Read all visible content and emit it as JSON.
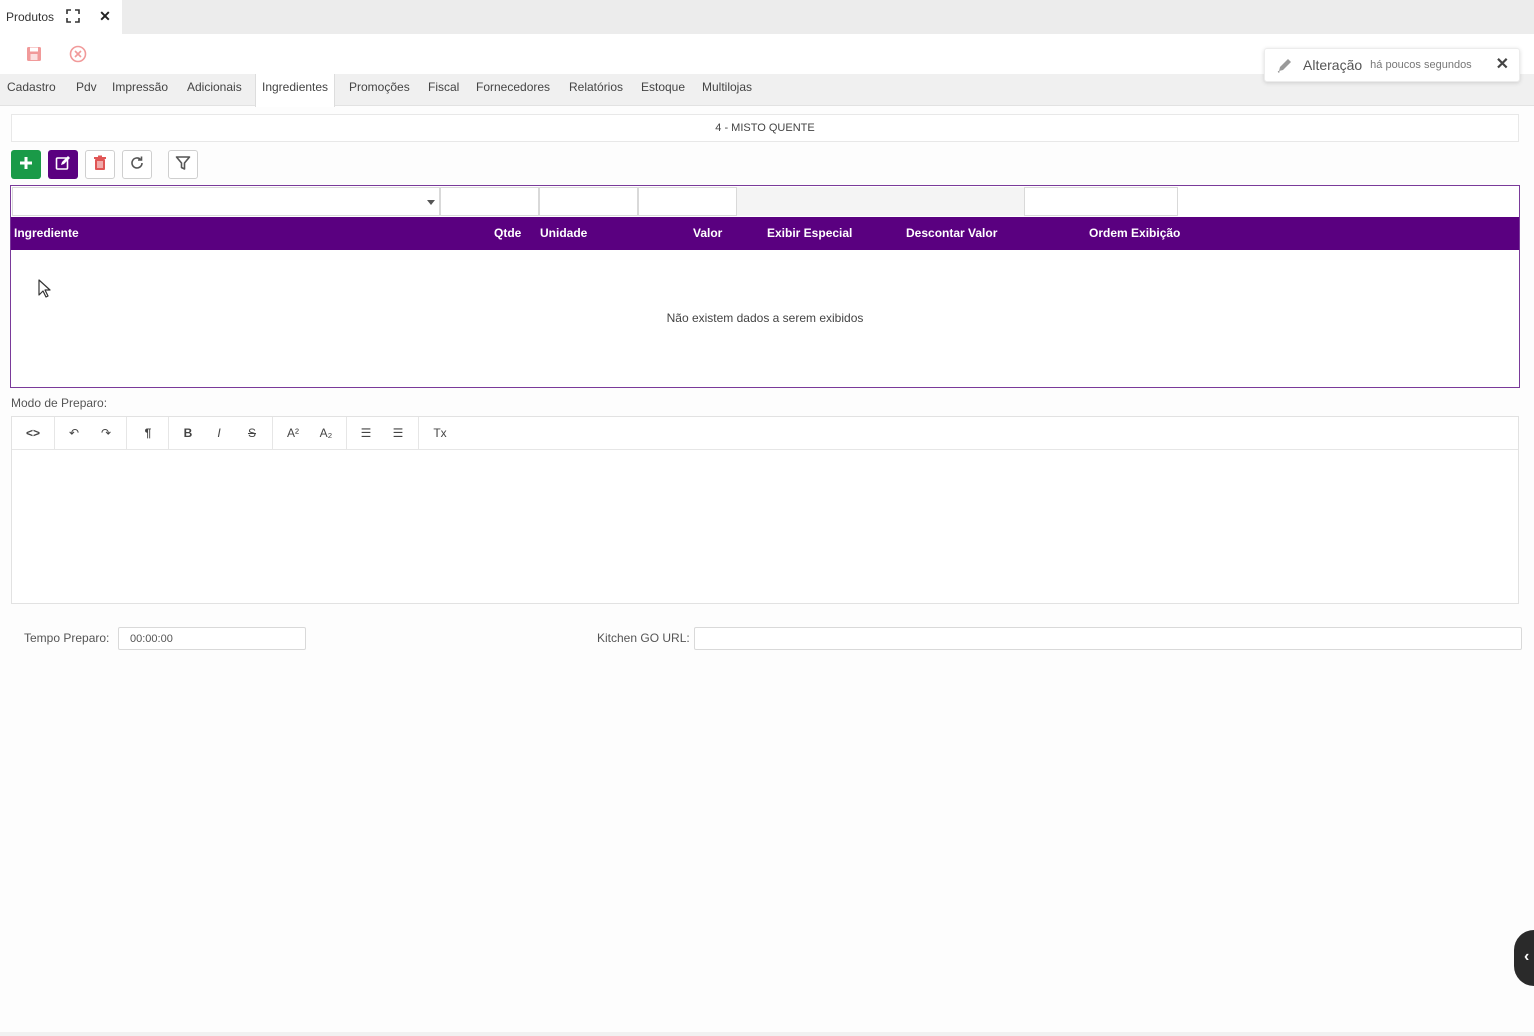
{
  "window": {
    "tab_title": "Produtos",
    "maximize_icon": "expand-icon",
    "close_icon": "close-icon",
    "close_glyph": "✕"
  },
  "actions": {
    "save_icon": "save-icon",
    "cancel_icon": "cancel-circle-icon"
  },
  "notification": {
    "icon": "pencil-icon",
    "title": "Alteração",
    "time": "há poucos segundos",
    "close_glyph": "✕"
  },
  "tabs": [
    {
      "label": "Cadastro"
    },
    {
      "label": "Pdv"
    },
    {
      "label": "Impressão"
    },
    {
      "label": "Adicionais"
    },
    {
      "label": "Ingredientes",
      "active": true
    },
    {
      "label": "Promoções"
    },
    {
      "label": "Fiscal"
    },
    {
      "label": "Fornecedores"
    },
    {
      "label": "Relatórios"
    },
    {
      "label": "Estoque"
    },
    {
      "label": "Multilojas"
    }
  ],
  "product": {
    "title": "4 - MISTO QUENTE"
  },
  "toolbar": {
    "add_icon": "plus-icon",
    "edit_icon": "edit-icon",
    "delete_icon": "trash-icon",
    "refresh_icon": "refresh-icon",
    "filter_icon": "filter-icon"
  },
  "grid": {
    "columns": [
      "Ingrediente",
      "Qtde",
      "Unidade",
      "Valor",
      "Exibir Especial",
      "Descontar Valor",
      "Ordem Exibição"
    ],
    "empty_message": "Não existem dados a serem exibidos",
    "header_color": "#5a0080"
  },
  "preparation": {
    "label": "Modo de Preparo:",
    "tools": {
      "code": "<>",
      "undo": "↶",
      "redo": "↷",
      "paragraph": "¶",
      "bold": "B",
      "italic": "I",
      "strike": "S",
      "superscript": "A²",
      "subscript": "A₂",
      "bullet_list": "☰",
      "ordered_list": "☰",
      "clear_format": "Tx"
    }
  },
  "fields": {
    "tempo_label": "Tempo Preparo:",
    "tempo_value": "00:00:00",
    "kitchen_label": "Kitchen GO URL:",
    "kitchen_value": ""
  },
  "side_handle": {
    "icon": "chevron-left-icon",
    "glyph": "‹"
  },
  "colors": {
    "accent": "#5a0080",
    "add_button": "#1a9a48",
    "delete_icon": "#e05555"
  }
}
